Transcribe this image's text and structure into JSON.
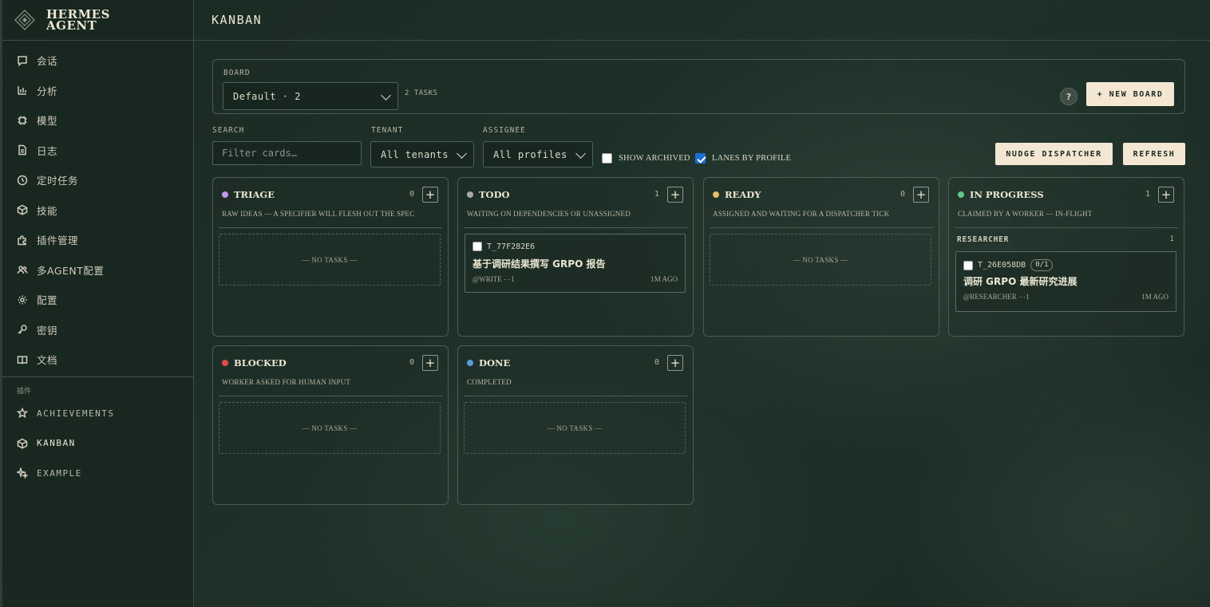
{
  "brand": {
    "line1": "HERMES",
    "line2": "AGENT"
  },
  "sidebar": {
    "items": [
      {
        "label": "会话",
        "icon": "chat-icon"
      },
      {
        "label": "分析",
        "icon": "bar-chart-icon"
      },
      {
        "label": "模型",
        "icon": "cpu-icon"
      },
      {
        "label": "日志",
        "icon": "file-icon"
      },
      {
        "label": "定时任务",
        "icon": "clock-icon"
      },
      {
        "label": "技能",
        "icon": "package-icon"
      },
      {
        "label": "插件管理",
        "icon": "puzzle-icon"
      },
      {
        "label": "多AGENT配置",
        "icon": "users-icon"
      },
      {
        "label": "配置",
        "icon": "gear-icon"
      },
      {
        "label": "密钥",
        "icon": "key-icon"
      },
      {
        "label": "文档",
        "icon": "book-icon"
      }
    ],
    "section_label": "插件",
    "plugins": [
      {
        "label": "ACHIEVEMENTS",
        "icon": "star-icon"
      },
      {
        "label": "KANBAN",
        "icon": "box-icon"
      },
      {
        "label": "EXAMPLE",
        "icon": "sparkle-icon"
      }
    ]
  },
  "header": {
    "title": "KANBAN"
  },
  "board": {
    "label": "BOARD",
    "selected": "Default · 2",
    "task_count": "2 TASKS",
    "help": "?",
    "new_board": "+ NEW BOARD"
  },
  "filters": {
    "search_label": "SEARCH",
    "search_placeholder": "Filter cards…",
    "tenant_label": "TENANT",
    "tenant_value": "All tenants",
    "assignee_label": "ASSIGNEE",
    "assignee_value": "All profiles",
    "show_archived": "SHOW ARCHIVED",
    "lanes_by_profile": "LANES BY PROFILE",
    "nudge": "NUDGE DISPATCHER",
    "refresh": "REFRESH"
  },
  "columns": {
    "triage": {
      "title": "TRIAGE",
      "count": "0",
      "desc": "RAW IDEAS — A SPECIFIER WILL FLESH OUT THE SPEC",
      "empty": "— NO TASKS —",
      "color": "#c49ae8"
    },
    "todo": {
      "title": "TODO",
      "count": "1",
      "desc": "WAITING ON DEPENDENCIES OR UNASSIGNED",
      "color": "#a9a9a9"
    },
    "ready": {
      "title": "READY",
      "count": "0",
      "desc": "ASSIGNED AND WAITING FOR A DISPATCHER TICK",
      "empty": "— NO TASKS —",
      "color": "#e3c06a"
    },
    "in_progress": {
      "title": "IN PROGRESS",
      "count": "1",
      "desc": "CLAIMED BY A WORKER — IN-FLIGHT",
      "color": "#5fc88a",
      "lane": "RESEARCHER",
      "lane_count": "1"
    },
    "blocked": {
      "title": "BLOCKED",
      "count": "0",
      "desc": "WORKER ASKED FOR HUMAN INPUT",
      "empty": "— NO TASKS —",
      "color": "#e04a4a"
    },
    "done": {
      "title": "DONE",
      "count": "0",
      "desc": "COMPLETED",
      "empty": "— NO TASKS —",
      "color": "#5b9ae0"
    }
  },
  "cards": {
    "todo_card": {
      "id": "T_77F282E6",
      "title": "基于调研结果撰写 GRPO 报告",
      "meta": "@WRITE  ⋯1",
      "time": "1M AGO"
    },
    "progress_card": {
      "id": "T_26E058DB",
      "badge": "0/1",
      "title": "调研 GRPO 最新研究进展",
      "meta": "@RESEARCHER  ⋯1",
      "time": "1M AGO"
    }
  }
}
